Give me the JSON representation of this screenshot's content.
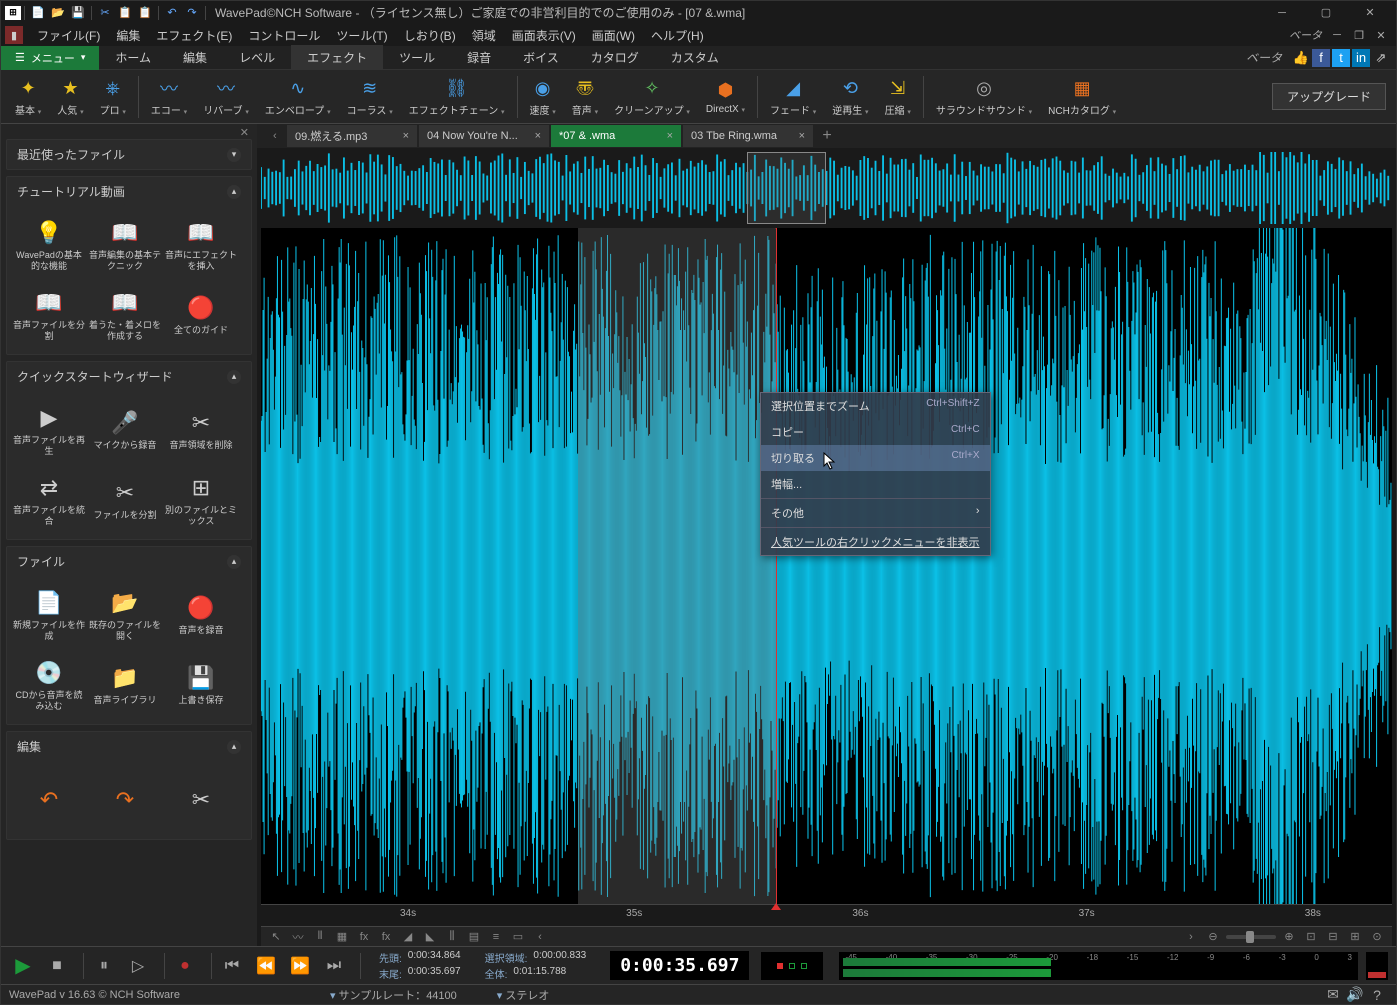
{
  "title": "WavePad©NCH Software -  （ライセンス無し）ご家庭での非営利目的でのご使用のみ - [07 &.wma]",
  "menubar": [
    "ファイル(F)",
    "編集",
    "エフェクト(E)",
    "コントロール",
    "ツール(T)",
    "しおり(B)",
    "領域",
    "画面表示(V)",
    "画面(W)",
    "ヘルプ(H)"
  ],
  "beta_label": "ベータ",
  "ribbon": {
    "menu_label": "メニュー",
    "tabs": [
      "ホーム",
      "編集",
      "レベル",
      "エフェクト",
      "ツール",
      "録音",
      "ボイス",
      "カタログ",
      "カスタム"
    ],
    "active_tab": 3,
    "beta2": "ベータ"
  },
  "toolbar": {
    "items": [
      {
        "label": "基本",
        "icon": "✦",
        "color": "#e8c020"
      },
      {
        "label": "人気",
        "icon": "★",
        "color": "#e8c020"
      },
      {
        "label": "プロ",
        "icon": "⎈",
        "color": "#4aa0e8"
      },
      {
        "label": "エコー",
        "icon": "〰",
        "color": "#4aa0e8",
        "sep_before": true
      },
      {
        "label": "リバーブ",
        "icon": "〰",
        "color": "#4aa0e8"
      },
      {
        "label": "エンベロープ",
        "icon": "∿",
        "color": "#4aa0e8"
      },
      {
        "label": "コーラス",
        "icon": "≋",
        "color": "#4aa0e8"
      },
      {
        "label": "エフェクトチェーン",
        "icon": "⛓",
        "color": "#4aa0e8"
      },
      {
        "label": "速度",
        "icon": "◉",
        "color": "#4aa0e8",
        "sep_before": true
      },
      {
        "label": "音声",
        "icon": "〠",
        "color": "#e8c020"
      },
      {
        "label": "クリーンアップ",
        "icon": "✧",
        "color": "#60c060"
      },
      {
        "label": "DirectX",
        "icon": "⬢",
        "color": "#e87020"
      },
      {
        "label": "フェード",
        "icon": "◢",
        "color": "#4aa0e8",
        "sep_before": true
      },
      {
        "label": "逆再生",
        "icon": "⟲",
        "color": "#4aa0e8"
      },
      {
        "label": "圧縮",
        "icon": "⇲",
        "color": "#e8c020"
      },
      {
        "label": "サラウンドサウンド",
        "icon": "◎",
        "color": "#aaa",
        "sep_before": true
      },
      {
        "label": "NCHカタログ",
        "icon": "▦",
        "color": "#e87020"
      }
    ],
    "upgrade": "アップグレード"
  },
  "sidebar": {
    "recent": {
      "title": "最近使ったファイル"
    },
    "tutorial": {
      "title": "チュートリアル動画",
      "items": [
        {
          "label": "WavePadの基本的な機能",
          "icon": "💡"
        },
        {
          "label": "音声編集の基本テクニック",
          "icon": "📖"
        },
        {
          "label": "音声にエフェクトを挿入",
          "icon": "📖"
        },
        {
          "label": "音声ファイルを分割",
          "icon": "📖"
        },
        {
          "label": "着うた・着メロを作成する",
          "icon": "📖"
        },
        {
          "label": "全てのガイド",
          "icon": "🔴"
        }
      ]
    },
    "quickstart": {
      "title": "クイックスタートウィザード",
      "items": [
        {
          "label": "音声ファイルを再生",
          "icon": "▶"
        },
        {
          "label": "マイクから録音",
          "icon": "🎤"
        },
        {
          "label": "音声領域を削除",
          "icon": "✂"
        },
        {
          "label": "音声ファイルを統合",
          "icon": "⇄"
        },
        {
          "label": "ファイルを分割",
          "icon": "✂"
        },
        {
          "label": "別のファイルとミックス",
          "icon": "⊞"
        }
      ]
    },
    "file": {
      "title": "ファイル",
      "items": [
        {
          "label": "新規ファイルを作成",
          "icon": "📄"
        },
        {
          "label": "既存のファイルを開く",
          "icon": "📂"
        },
        {
          "label": "音声を録音",
          "icon": "🔴"
        },
        {
          "label": "CDから音声を読み込む",
          "icon": "💿"
        },
        {
          "label": "音声ライブラリ",
          "icon": "📁"
        },
        {
          "label": "上書き保存",
          "icon": "💾"
        }
      ]
    },
    "edit": {
      "title": "編集"
    }
  },
  "file_tabs": [
    {
      "label": "09.燃える.mp3",
      "active": false
    },
    {
      "label": "04 Now  You're  N...",
      "active": false
    },
    {
      "label": "*07 & .wma",
      "active": true
    },
    {
      "label": "03 Tbe Ring.wma",
      "active": false
    }
  ],
  "timeline": {
    "ticks": [
      "34s",
      "35s",
      "36s",
      "37s",
      "38s"
    ]
  },
  "transport": {
    "times": {
      "sentou_lbl": "先頭:",
      "sentou": "0:00:34.864",
      "matsubi_lbl": "末尾:",
      "matsubi": "0:00:35.697",
      "sentaku_lbl": "選択領域:",
      "sentaku": "0:00:00.833",
      "zentai_lbl": "全体:",
      "zentai": "0:01:15.788"
    },
    "big_time": "0:00:35.697",
    "meter_scale": [
      "-45",
      "-40",
      "-35",
      "-30",
      "-25",
      "-20",
      "-18",
      "-15",
      "-12",
      "-9",
      "-6",
      "-3",
      "0",
      "3"
    ]
  },
  "status": {
    "app": "WavePad v 16.63 © NCH Software",
    "sample_lbl": "サンプルレート：",
    "sample": "44100",
    "stereo": "ステレオ"
  },
  "context_menu": {
    "items": [
      {
        "label": "選択位置までズーム",
        "shortcut": "Ctrl+Shift+Z"
      },
      {
        "label": "コピー",
        "shortcut": "Ctrl+C"
      },
      {
        "label": "切り取る",
        "shortcut": "Ctrl+X",
        "hover": true
      },
      {
        "label": "増幅..."
      },
      {
        "label": "その他",
        "submenu": true
      },
      {
        "label": "人気ツールの右クリックメニューを非表示",
        "underline": true
      }
    ]
  }
}
